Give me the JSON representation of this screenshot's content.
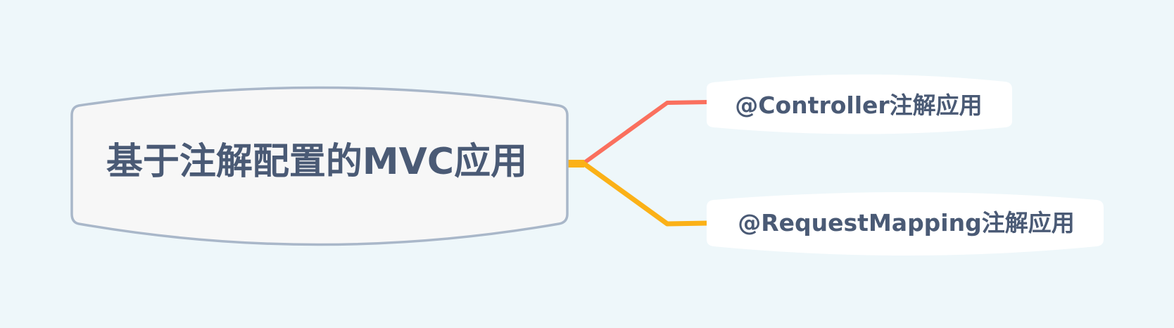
{
  "mindmap": {
    "root": {
      "label": "基于注解配置的MVC应用"
    },
    "children": [
      {
        "label": "@Controller注解应用",
        "branch_color": "#fa705e"
      },
      {
        "label": "@RequestMapping注解应用",
        "branch_color": "#fbb117"
      }
    ],
    "colors": {
      "background": "#eef7fa",
      "root_fill": "#f7f7f7",
      "root_border": "#a9b7c9",
      "text": "#4a5a75",
      "child_fill": "#ffffff"
    }
  }
}
